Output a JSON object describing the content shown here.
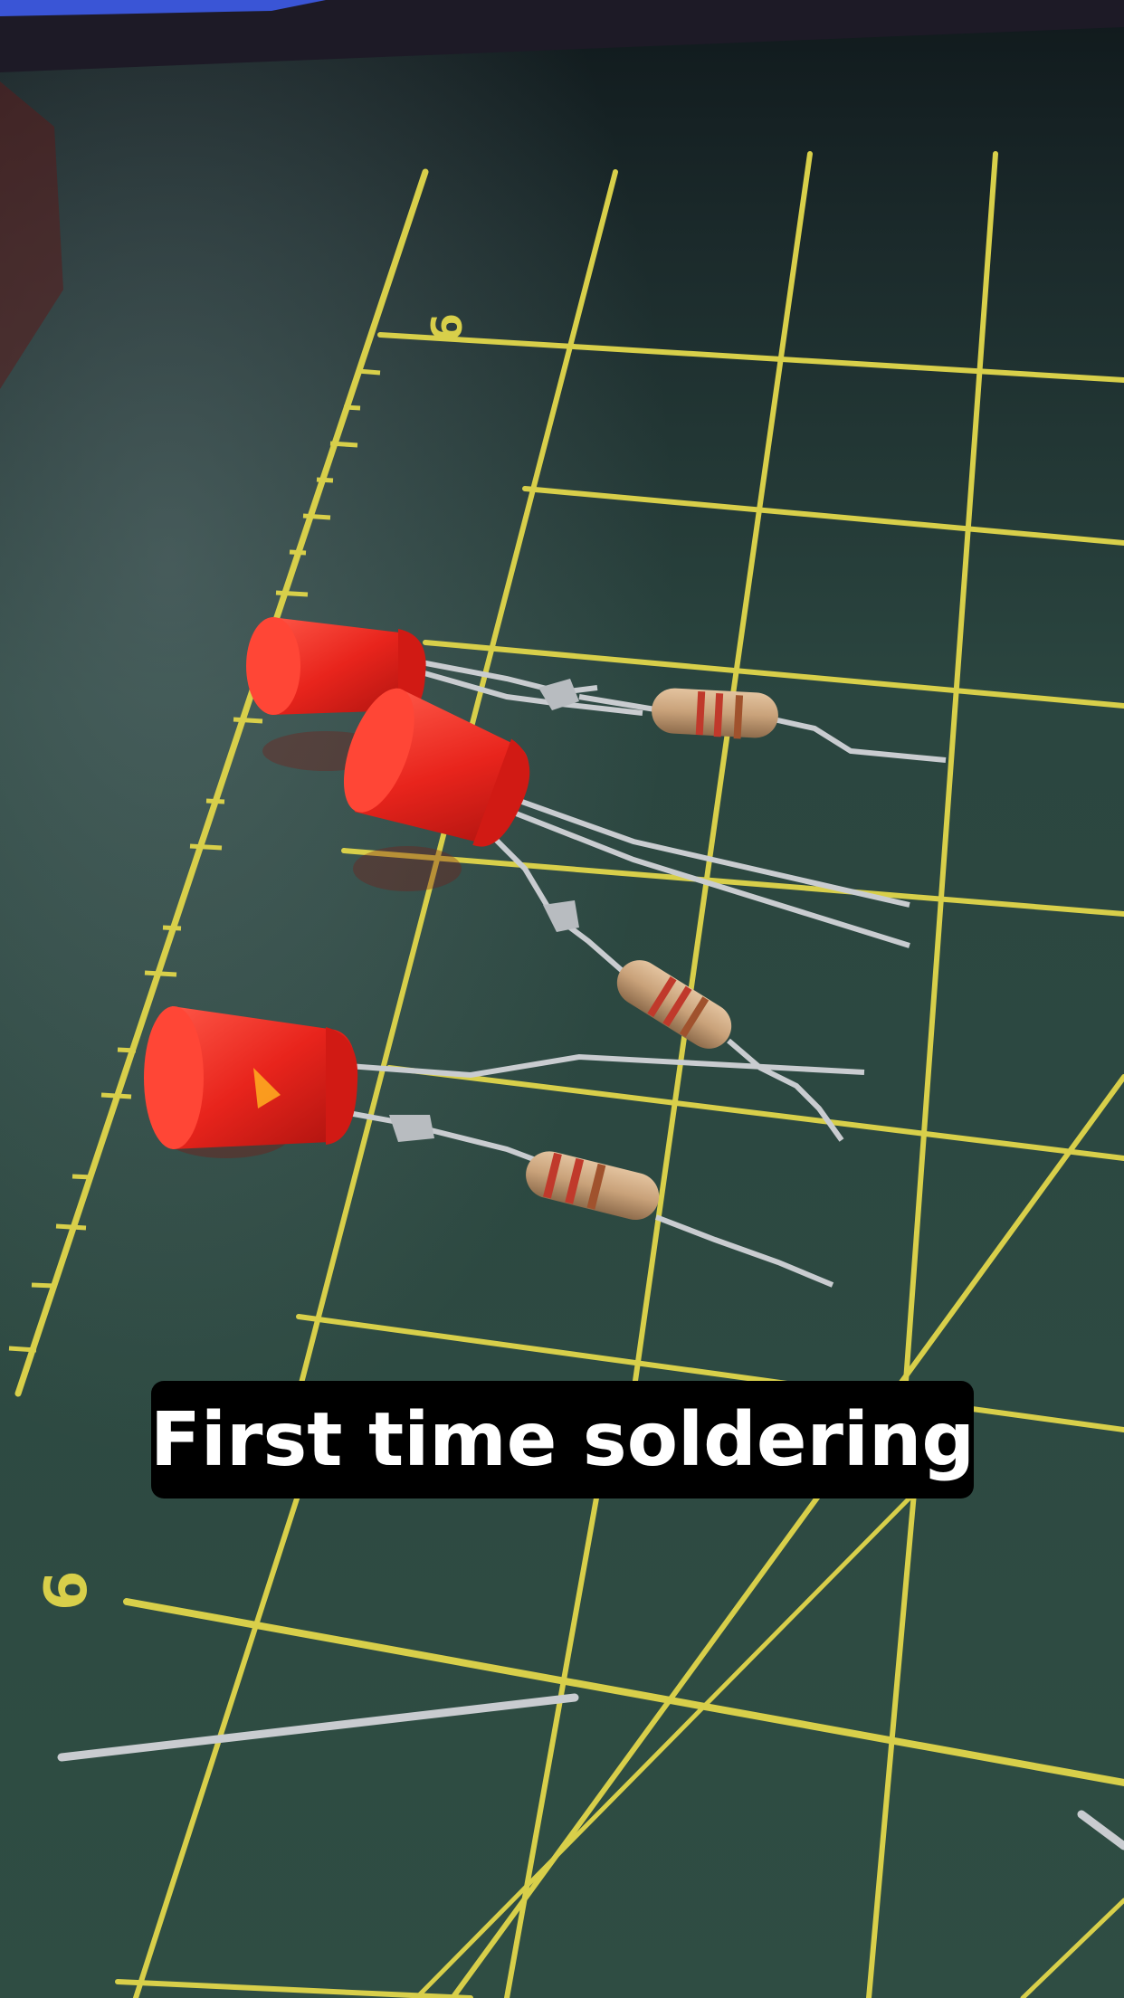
{
  "caption": "First time soldering",
  "mat_numbers": [
    "6",
    "6"
  ],
  "colors": {
    "mat_green": "#2c4a41",
    "grid_yellow": "#d8cf4a",
    "led_red": "#e8241c",
    "resistor_beige": "#c9a27a",
    "band_red": "#c0392b",
    "wire_silver": "#c9ccd0"
  }
}
